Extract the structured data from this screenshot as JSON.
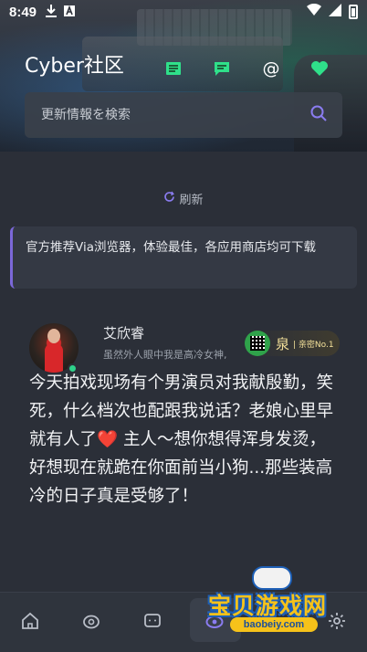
{
  "status_bar": {
    "time": "8:49",
    "icons": [
      "download-icon",
      "a-icon",
      "wifi-icon",
      "cellular-icon",
      "battery-icon"
    ]
  },
  "header": {
    "app_title": "Cyber社区",
    "icons": [
      "book-icon",
      "message-icon",
      "at-icon",
      "heart-icon"
    ],
    "at_glyph": "@",
    "accent_color": "#2fe08a"
  },
  "search": {
    "placeholder": "更新情報を検索"
  },
  "refresh": {
    "label": "刷新"
  },
  "notice": {
    "text": "官方推荐Via浏览器，体验最佳，各应用商店均可下载",
    "accent_color": "#7b68d9"
  },
  "post": {
    "username": "艾欣睿",
    "signature": "虽然外人眼中我是高冷女神,",
    "badge": {
      "name": "泉",
      "title": "| 亲密No.1"
    },
    "body_part1": "今天拍戏现场有个男演员对我献殷勤，笑死，什么档次也配跟我说话？老娘心里早就有人了",
    "emoji": "❤️",
    "body_part2": " 主人～想你想得浑身发烫，好想现在就跪在你面前当小狗...那些装高冷的日子真是受够了！"
  },
  "bottom_nav": {
    "items": [
      "home-icon",
      "discover-icon",
      "chat-icon",
      "community-icon",
      "settings-icon"
    ],
    "active_index": 3
  },
  "watermark": {
    "text": "宝贝游戏网",
    "url": "baobeiy.com"
  }
}
